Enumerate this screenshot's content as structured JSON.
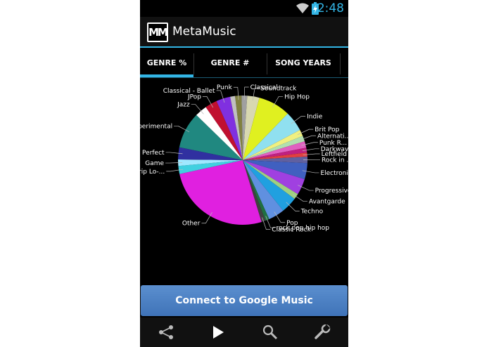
{
  "status_bar": {
    "time": "2:48",
    "icons": [
      "wifi-icon",
      "battery-charging-icon"
    ]
  },
  "app": {
    "logo_text": "MM",
    "title": "MetaMusic"
  },
  "tabs": [
    {
      "label": "GENRE %",
      "selected": true
    },
    {
      "label": "GENRE #",
      "selected": false
    },
    {
      "label": "SONG YEARS",
      "selected": false
    }
  ],
  "chart_data": {
    "type": "pie",
    "slices": [
      {
        "label": "Punk",
        "value": 1.6,
        "color": "#808040"
      },
      {
        "label": "Classical",
        "value": 1.4,
        "color": "#a0a0a0"
      },
      {
        "label": "Soundtrack",
        "value": 3.0,
        "color": "#d8d8b0"
      },
      {
        "label": "Hip Hop",
        "value": 8.0,
        "color": "#e0f020"
      },
      {
        "label": "Indie",
        "value": 5.0,
        "color": "#90e0f0"
      },
      {
        "label": "Brit Pop",
        "value": 1.6,
        "color": "#f0f080"
      },
      {
        "label": "Alternati...",
        "value": 1.4,
        "color": "#b0e0b0"
      },
      {
        "label": "Punk R...",
        "value": 1.6,
        "color": "#e060c0"
      },
      {
        "label": "Darkwave",
        "value": 1.2,
        "color": "#c02080"
      },
      {
        "label": "Leftfield",
        "value": 1.0,
        "color": "#e04040"
      },
      {
        "label": "Rock in ...",
        "value": 1.6,
        "color": "#6060a0"
      },
      {
        "label": "Electronica",
        "value": 4.0,
        "color": "#4060c0"
      },
      {
        "label": "Progressive R...",
        "value": 4.0,
        "color": "#a040e0"
      },
      {
        "label": "Avantgarde",
        "value": 1.4,
        "color": "#a0d080"
      },
      {
        "label": "Techno",
        "value": 4.0,
        "color": "#20a0e0"
      },
      {
        "label": "Pop",
        "value": 4.0,
        "color": "#6090e0"
      },
      {
        "label": "rock pop hip hop",
        "value": 1.0,
        "color": "#207040"
      },
      {
        "label": "Classic Rock",
        "value": 1.0,
        "color": "#404040"
      },
      {
        "label": "Other",
        "value": 26.0,
        "color": "#e020e0"
      },
      {
        "label": "Trip Lo-...",
        "value": 2.0,
        "color": "#40d0e0"
      },
      {
        "label": "Game",
        "value": 1.6,
        "color": "#a0e8ff"
      },
      {
        "label": "Perfect",
        "value": 3.0,
        "color": "#3030a0"
      },
      {
        "label": "Experimental",
        "value": 9.0,
        "color": "#208880"
      },
      {
        "label": "Jazz",
        "value": 3.0,
        "color": "#ffffff"
      },
      {
        "label": "JPop",
        "value": 3.0,
        "color": "#c01030"
      },
      {
        "label": "Classical - Ballet",
        "value": 3.5,
        "color": "#8030e0"
      },
      {
        "label": "",
        "value": 1.2,
        "color": "#c0c0c0"
      }
    ],
    "grid": false
  },
  "connect_button": {
    "label": "Connect to Google Music"
  },
  "bottom_bar": {
    "buttons": [
      {
        "icon": "share-icon"
      },
      {
        "icon": "play-icon"
      },
      {
        "icon": "search-icon"
      },
      {
        "icon": "wrench-icon"
      }
    ]
  },
  "colors": {
    "accent": "#33b5e5",
    "button": "#4a7fc4",
    "background": "#000000"
  }
}
